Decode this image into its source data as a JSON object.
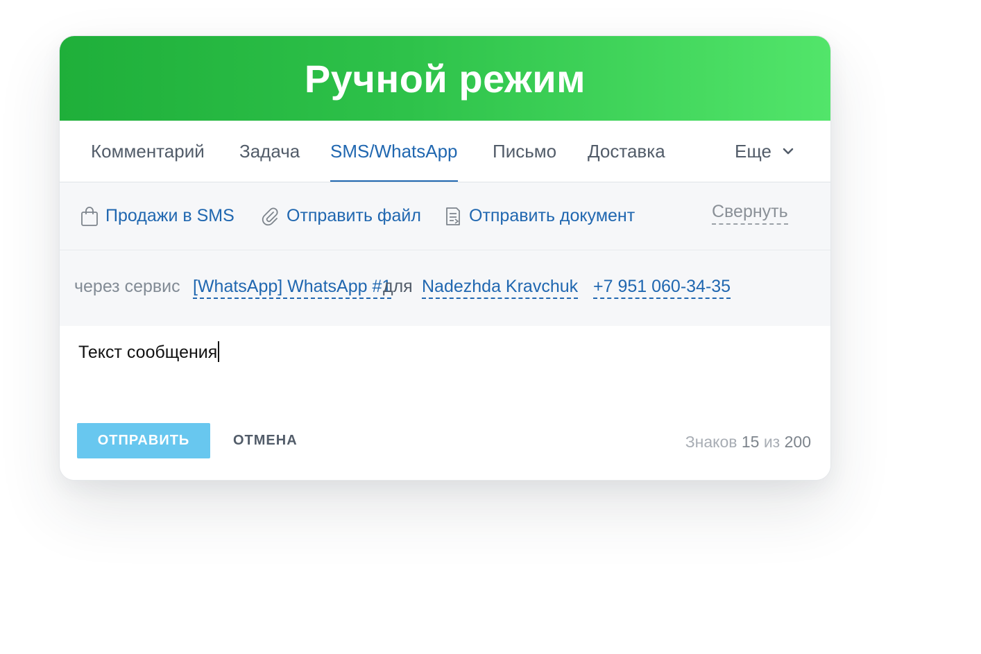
{
  "header": {
    "title": "Ручной режим"
  },
  "tabs": [
    {
      "label": "Комментарий",
      "active": false
    },
    {
      "label": "Задача",
      "active": false
    },
    {
      "label": "SMS/WhatsApp",
      "active": true
    },
    {
      "label": "Письмо",
      "active": false
    },
    {
      "label": "Доставка",
      "active": false
    }
  ],
  "more_tab": {
    "label": "Еще",
    "icon": "chevron-down-icon"
  },
  "actions": {
    "sales_sms": {
      "label": "Продажи в SMS",
      "icon": "shopping-bag-icon"
    },
    "send_file": {
      "label": "Отправить файл",
      "icon": "paperclip-icon"
    },
    "send_document": {
      "label": "Отправить документ",
      "icon": "document-icon"
    },
    "collapse_label": "Свернуть"
  },
  "service": {
    "via_label": "через сервис",
    "service_name": "[WhatsApp] WhatsApp #1",
    "for_label": "для",
    "contact_name": "Nadezhda Kravchuk",
    "phone": "+7 951 060-34-35"
  },
  "message": {
    "text": "Текст сообщения"
  },
  "footer": {
    "send_label": "ОТПРАВИТЬ",
    "cancel_label": "ОТМЕНА",
    "counter_prefix": "Знаков",
    "counter_current": "15",
    "counter_of": "из",
    "counter_max": "200"
  },
  "colors": {
    "header_gradient_start": "#1faf3a",
    "header_gradient_end": "#52e56a",
    "link": "#2067b0",
    "send_button": "#68c7ef"
  }
}
